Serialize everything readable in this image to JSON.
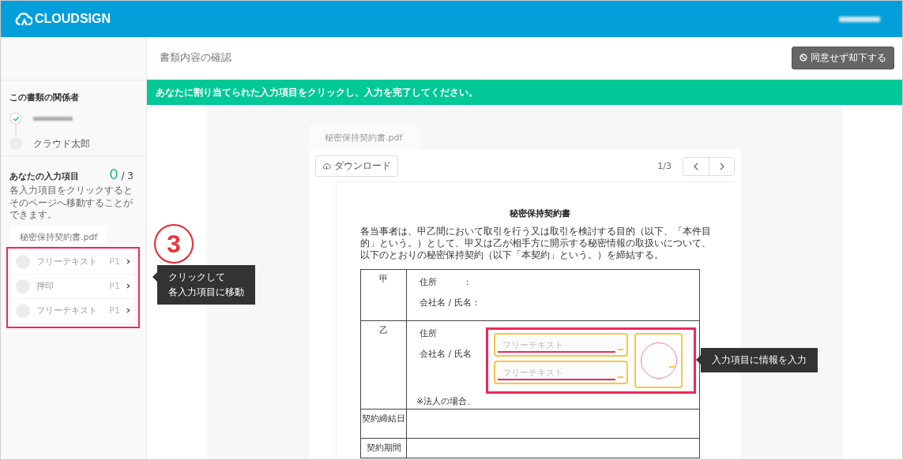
{
  "header": {
    "logo": "CLOUDSIGN"
  },
  "page_title": "書類内容の確認",
  "reject_button": {
    "label": "同意せず却下する"
  },
  "banner": "あなたに割り当てられた入力項目をクリックし、入力を完了してください。",
  "sidebar": {
    "participants_title": "この書類の関係者",
    "participants": [
      {
        "redacted": true,
        "done": true
      },
      {
        "name": "クラウド太郎",
        "redacted": false,
        "done": false
      }
    ],
    "inputs_title": "あなたの入力項目",
    "count_done": "0",
    "count_separator": "/",
    "count_total": "3",
    "hint": "各入力項目をクリックするとそのページへ移動することができます。",
    "file_tab": "秘密保持契約書.pdf",
    "items": [
      {
        "label": "フリーテキスト",
        "page": "P1",
        "done": false
      },
      {
        "label": "押印",
        "page": "P1",
        "done": false
      },
      {
        "label": "フリーテキスト",
        "page": "P1",
        "done": false
      }
    ]
  },
  "viewer": {
    "tab": "秘密保持契約書.pdf",
    "download": "ダウンロード",
    "page_indicator": "1/3"
  },
  "document": {
    "title": "秘密保持契約書",
    "intro": "各当事者は、甲乙間において取引を行う又は取引を検討する目的（以下、「本件目的」という。）として、甲又は乙が相手方に開示する秘密情報の取扱いについて、以下のとおりの秘密保持契約（以下「本契約」という。）を締結する。",
    "parties": [
      {
        "label": "甲",
        "address_label": "住所　　　：",
        "name_label": "会社名 / 氏名："
      },
      {
        "label": "乙",
        "address_label": "住所",
        "name_label": "会社名 / 氏名",
        "note": "※法人の場合、",
        "has_fields": true
      }
    ],
    "rows": [
      "契約締結日",
      "契約期間"
    ]
  },
  "fields": [
    {
      "kind": "text",
      "placeholder": "フリーテキスト"
    },
    {
      "kind": "text",
      "placeholder": "フリーテキスト"
    },
    {
      "kind": "stamp"
    }
  ],
  "annotations": {
    "step": "3",
    "sidebar_callout": [
      "クリックして",
      "各入力項目に移動"
    ],
    "fields_callout": "入力項目に情報を入力"
  }
}
